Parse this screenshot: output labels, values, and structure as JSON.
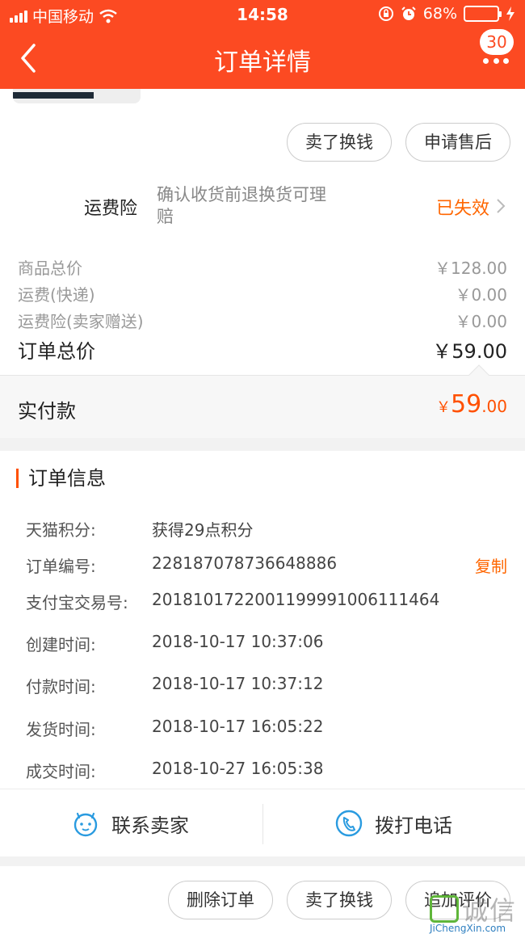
{
  "status_bar": {
    "carrier": "中国移动",
    "time": "14:58",
    "battery_percent": "68%"
  },
  "nav": {
    "title": "订单详情",
    "message_count": "30"
  },
  "actions_top": {
    "sell_label": "卖了换钱",
    "after_sale_label": "申请售后"
  },
  "insurance": {
    "label": "运费险",
    "description": "确认收货前退换货可理赔",
    "status": "已失效"
  },
  "prices": {
    "goods_label": "商品总价",
    "goods_value": "￥128.00",
    "shipping_label": "运费(快递)",
    "shipping_value": "￥0.00",
    "insurance_label": "运费险(卖家赠送)",
    "insurance_value": "￥0.00",
    "total_label": "订单总价",
    "total_value": "￥59.00"
  },
  "payment": {
    "label": "实付款",
    "currency": "￥",
    "amount_int": "59",
    "amount_dec": ".00"
  },
  "order_info": {
    "title": "订单信息",
    "rows": [
      {
        "label": "天猫积分:",
        "value": "获得29点积分"
      },
      {
        "label": "订单编号:",
        "value": "228187078736648886"
      },
      {
        "label": "支付宝交易号:",
        "value": "2018101722001199991006111464"
      },
      {
        "label": "创建时间:",
        "value": "2018-10-17 10:37:06"
      },
      {
        "label": "付款时间:",
        "value": "2018-10-17 10:37:12"
      },
      {
        "label": "发货时间:",
        "value": "2018-10-17 16:05:22"
      },
      {
        "label": "成交时间:",
        "value": "2018-10-27 16:05:38"
      }
    ],
    "copy_label": "复制"
  },
  "contact": {
    "seller_label": "联系卖家",
    "phone_label": "拨打电话"
  },
  "bottom_actions": {
    "delete_label": "删除订单",
    "sell_label": "卖了换钱",
    "review_label": "追加评价"
  },
  "watermark": {
    "text": "诚信",
    "site": "JiChengXin.com"
  },
  "colors": {
    "brand": "#fc4a22",
    "accent": "#ff5000",
    "battery": "#4cd964"
  },
  "icons": [
    "signal-icon",
    "wifi-icon",
    "lock-rotation-icon",
    "alarm-icon",
    "battery-icon",
    "charging-icon",
    "back-icon",
    "more-icon",
    "chevron-right-icon",
    "seller-chat-icon",
    "phone-icon"
  ]
}
